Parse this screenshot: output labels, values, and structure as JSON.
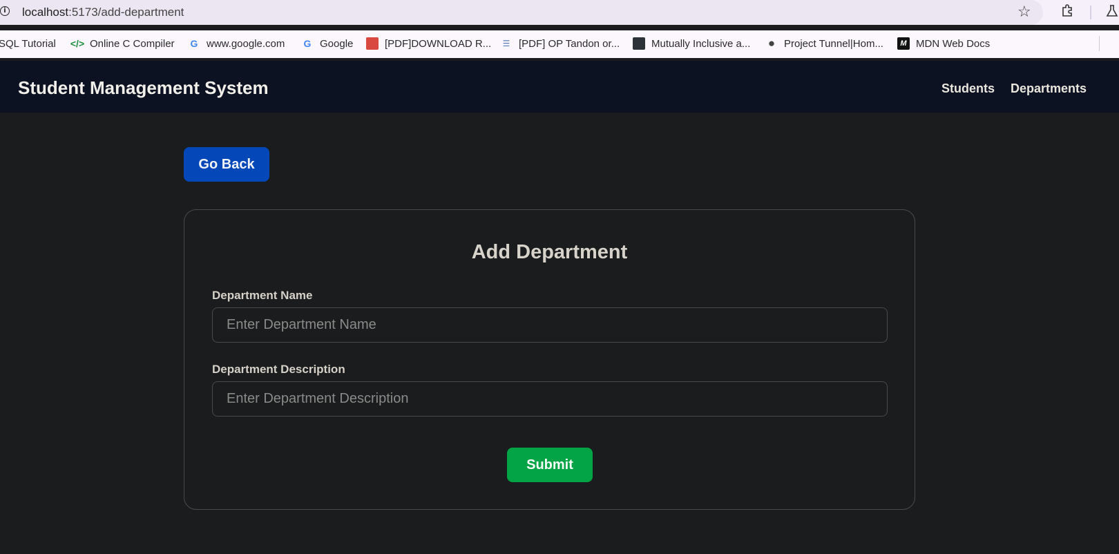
{
  "browser": {
    "url_host": "localhost",
    "url_path": ":5173/add-department",
    "bookmarks": [
      {
        "label": "SQL Tutorial",
        "icon": "sql-icon"
      },
      {
        "label": "Online C Compiler",
        "icon": "code-icon"
      },
      {
        "label": "www.google.com",
        "icon": "google-icon"
      },
      {
        "label": "Google",
        "icon": "google-icon"
      },
      {
        "label": "[PDF]DOWNLOAD R...",
        "icon": "pdf-icon"
      },
      {
        "label": "[PDF] OP Tandon or...",
        "icon": "pdf-icon"
      },
      {
        "label": "Mutually Inclusive a...",
        "icon": "site-icon"
      },
      {
        "label": "Project Tunnel|Hom...",
        "icon": "globe-icon"
      },
      {
        "label": "MDN Web Docs",
        "icon": "mdn-icon"
      }
    ]
  },
  "navbar": {
    "brand": "Student Management System",
    "links": [
      "Students",
      "Departments"
    ]
  },
  "page": {
    "back_label": "Go Back",
    "title": "Add Department",
    "fields": [
      {
        "label": "Department Name",
        "placeholder": "Enter Department Name",
        "value": ""
      },
      {
        "label": "Department Description",
        "placeholder": "Enter Department Description",
        "value": ""
      }
    ],
    "submit_label": "Submit"
  },
  "colors": {
    "background": "#1b1c1e",
    "navbar": "#0c1221",
    "back_button": "#0447b8",
    "submit_button": "#02a446"
  }
}
